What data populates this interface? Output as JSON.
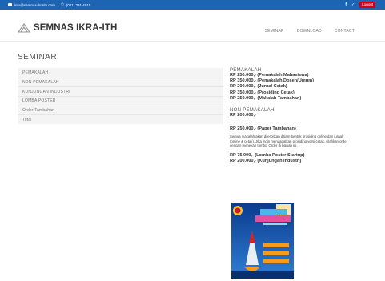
{
  "topbar": {
    "email": "info@semnas-ikraith.com",
    "separator": "|",
    "phone": "(021) 391 4015",
    "facebook": "f",
    "twitter": "✓",
    "logout_label": "Logout"
  },
  "header": {
    "brand": "SEMNAS IKRA-ITH",
    "nav": [
      "SEMINAR",
      "DOWNLOAD",
      "CONTACT"
    ]
  },
  "page": {
    "title": "SEMINAR"
  },
  "left_table": [
    "PEMAKALAH",
    "NON PEMAKALAH",
    "KUNJUNGAN INDUSTRI",
    "LOMBA POSTER",
    "Order Tambahan",
    "Total"
  ],
  "info": {
    "pemakalah_heading": "PEMAKALAH",
    "pemakalah_prices": [
      "RP 250.000,- (Pemakalah Mahasiswa)",
      "RP 350.000,- (Pemakalah Dosen/Umum)",
      "RP 200.000,- (Jurnal Cetak)",
      "RP 350.000,- (Prosiding Cetak)",
      "RP 250.000,- (Makalah Tambahan)"
    ],
    "non_pemakalah_heading": "NON PEMAKALAH",
    "non_pemakalah_price": "RP 200.000,-",
    "paper_tambahan": "RP 250.000,- (Paper Tambahan)",
    "note": "Semua makalah akan diterbitkan dalam bentuk prosiding online dan jurnal (online & cetak). Jika ingin mendapatkan prosiding versi cetak, silahkan order dengan menekan tombol Order di bawah ini.",
    "extra_prices": [
      "RP 75.000,- (Lomba Poster Startup)",
      "RP 200.000,- (Kunjungan Industri)"
    ]
  },
  "colors": {
    "topbar": "#1e64b4",
    "logout": "#d0021b",
    "poster_bg": "#0d3f93"
  }
}
